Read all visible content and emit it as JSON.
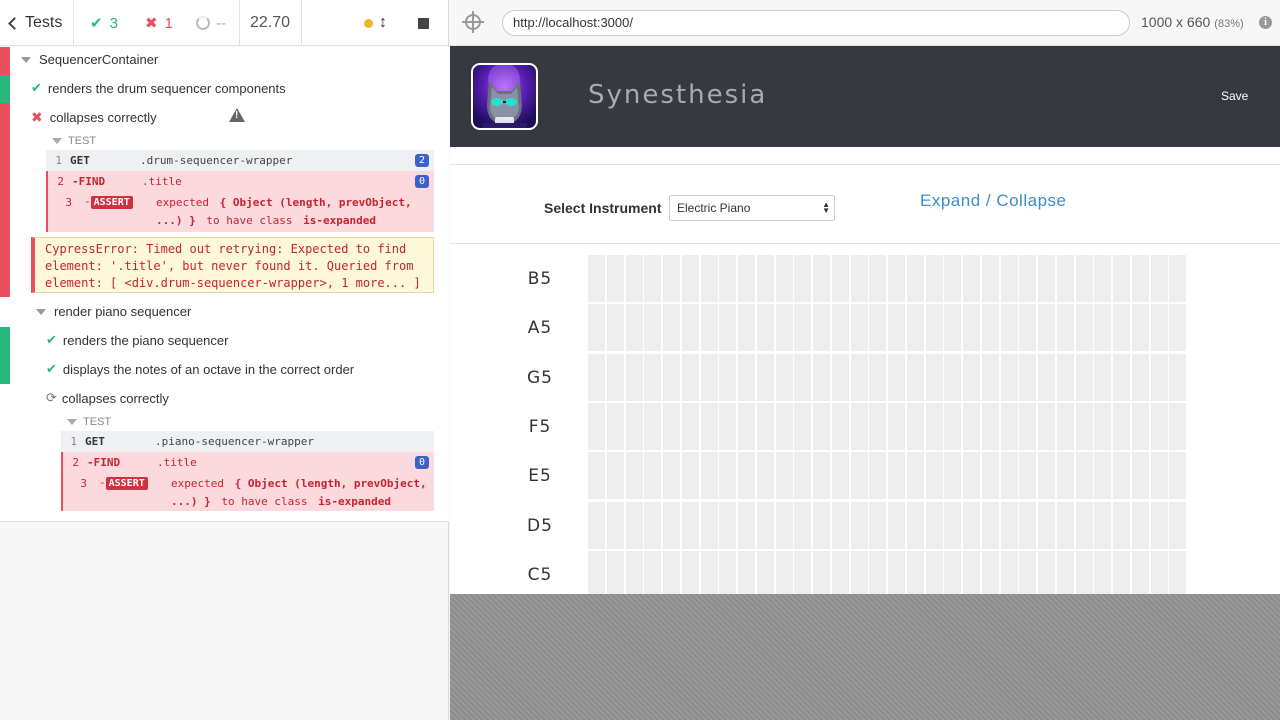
{
  "reporter": {
    "tests_label": "Tests",
    "passed": "3",
    "failed": "1",
    "pending": "--",
    "duration": "22.70",
    "suite1": {
      "title": "SequencerContainer",
      "test1": "renders the drum sequencer components",
      "test2": "collapses correctly",
      "test_label": "TEST",
      "commands": [
        {
          "num": "1",
          "name": "GET",
          "msg": ".drum-sequencer-wrapper",
          "badge": "2"
        },
        {
          "num": "2",
          "name": "-FIND",
          "msg": ".title",
          "badge": "0"
        },
        {
          "num": "3",
          "name": "ASSERT",
          "msg_prefix": "expected",
          "msg_obj": "{ Object (length, prevObject,",
          "msg_cont": "...) }",
          "msg_mid": "to have class",
          "msg_cls": "is-expanded"
        }
      ],
      "error": "CypressError: Timed out retrying: Expected to find element: '.title', but never found it. Queried from element: [ <div.drum-sequencer-wrapper>, 1 more... ]"
    },
    "suite2": {
      "title": "render piano sequencer",
      "test1": "renders the piano sequencer",
      "test2": "displays the notes of an octave in the correct order",
      "test3": "collapses correctly",
      "test_label": "TEST",
      "commands": [
        {
          "num": "1",
          "name": "GET",
          "msg": ".piano-sequencer-wrapper"
        },
        {
          "num": "2",
          "name": "-FIND",
          "msg": ".title",
          "badge": "0"
        },
        {
          "num": "3",
          "name": "ASSERT",
          "msg_prefix": "expected",
          "msg_obj": "{ Object (length, prevObject,",
          "msg_cont": "...) }",
          "msg_mid": "to have class",
          "msg_cls": "is-expanded"
        }
      ]
    }
  },
  "urlbar": {
    "url": "http://localhost:3000/",
    "viewport": "1000 x 660",
    "scale": "(83%)"
  },
  "app": {
    "title": "Synesthesia",
    "save": "Save",
    "instrument_label": "Select Instrument",
    "instrument_value": "Electric Piano",
    "expand_label": "Expand / Collapse",
    "notes": [
      "B5",
      "A5",
      "G5",
      "F5",
      "E5",
      "D5",
      "C5"
    ],
    "steps": 32
  },
  "colors": {
    "pass": "#29b77d",
    "fail": "#e94f5f",
    "header": "#363940",
    "link": "#3b8fc6"
  }
}
